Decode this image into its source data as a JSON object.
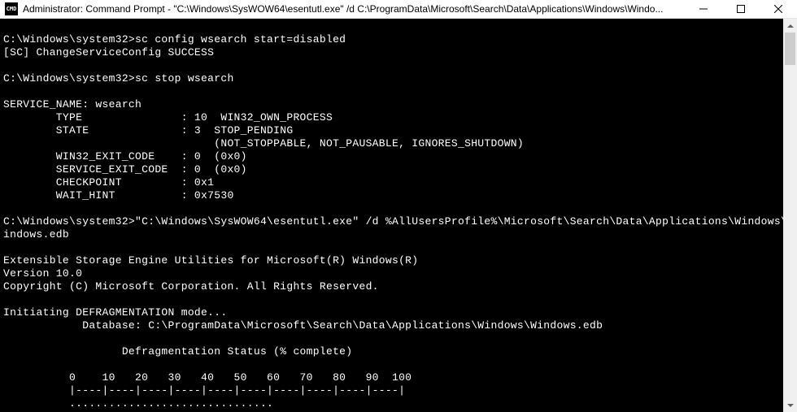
{
  "window": {
    "icon_label": "CMD",
    "title": "Administrator: Command Prompt - \"C:\\Windows\\SysWOW64\\esentutl.exe\"  /d C:\\ProgramData\\Microsoft\\Search\\Data\\Applications\\Windows\\Windo..."
  },
  "console": {
    "lines": [
      "",
      "C:\\Windows\\system32>sc config wsearch start=disabled",
      "[SC] ChangeServiceConfig SUCCESS",
      "",
      "C:\\Windows\\system32>sc stop wsearch",
      "",
      "SERVICE_NAME: wsearch",
      "        TYPE               : 10  WIN32_OWN_PROCESS",
      "        STATE              : 3  STOP_PENDING",
      "                                (NOT_STOPPABLE, NOT_PAUSABLE, IGNORES_SHUTDOWN)",
      "        WIN32_EXIT_CODE    : 0  (0x0)",
      "        SERVICE_EXIT_CODE  : 0  (0x0)",
      "        CHECKPOINT         : 0x1",
      "        WAIT_HINT          : 0x7530",
      "",
      "C:\\Windows\\system32>\"C:\\Windows\\SysWOW64\\esentutl.exe\" /d %AllUsersProfile%\\Microsoft\\Search\\Data\\Applications\\Windows\\W",
      "indows.edb",
      "",
      "Extensible Storage Engine Utilities for Microsoft(R) Windows(R)",
      "Version 10.0",
      "Copyright (C) Microsoft Corporation. All Rights Reserved.",
      "",
      "Initiating DEFRAGMENTATION mode...",
      "            Database: C:\\ProgramData\\Microsoft\\Search\\Data\\Applications\\Windows\\Windows.edb",
      "",
      "                  Defragmentation Status (% complete)",
      "",
      "          0    10   20   30   40   50   60   70   80   90  100",
      "          |----|----|----|----|----|----|----|----|----|----|",
      "          ..............................."
    ]
  }
}
